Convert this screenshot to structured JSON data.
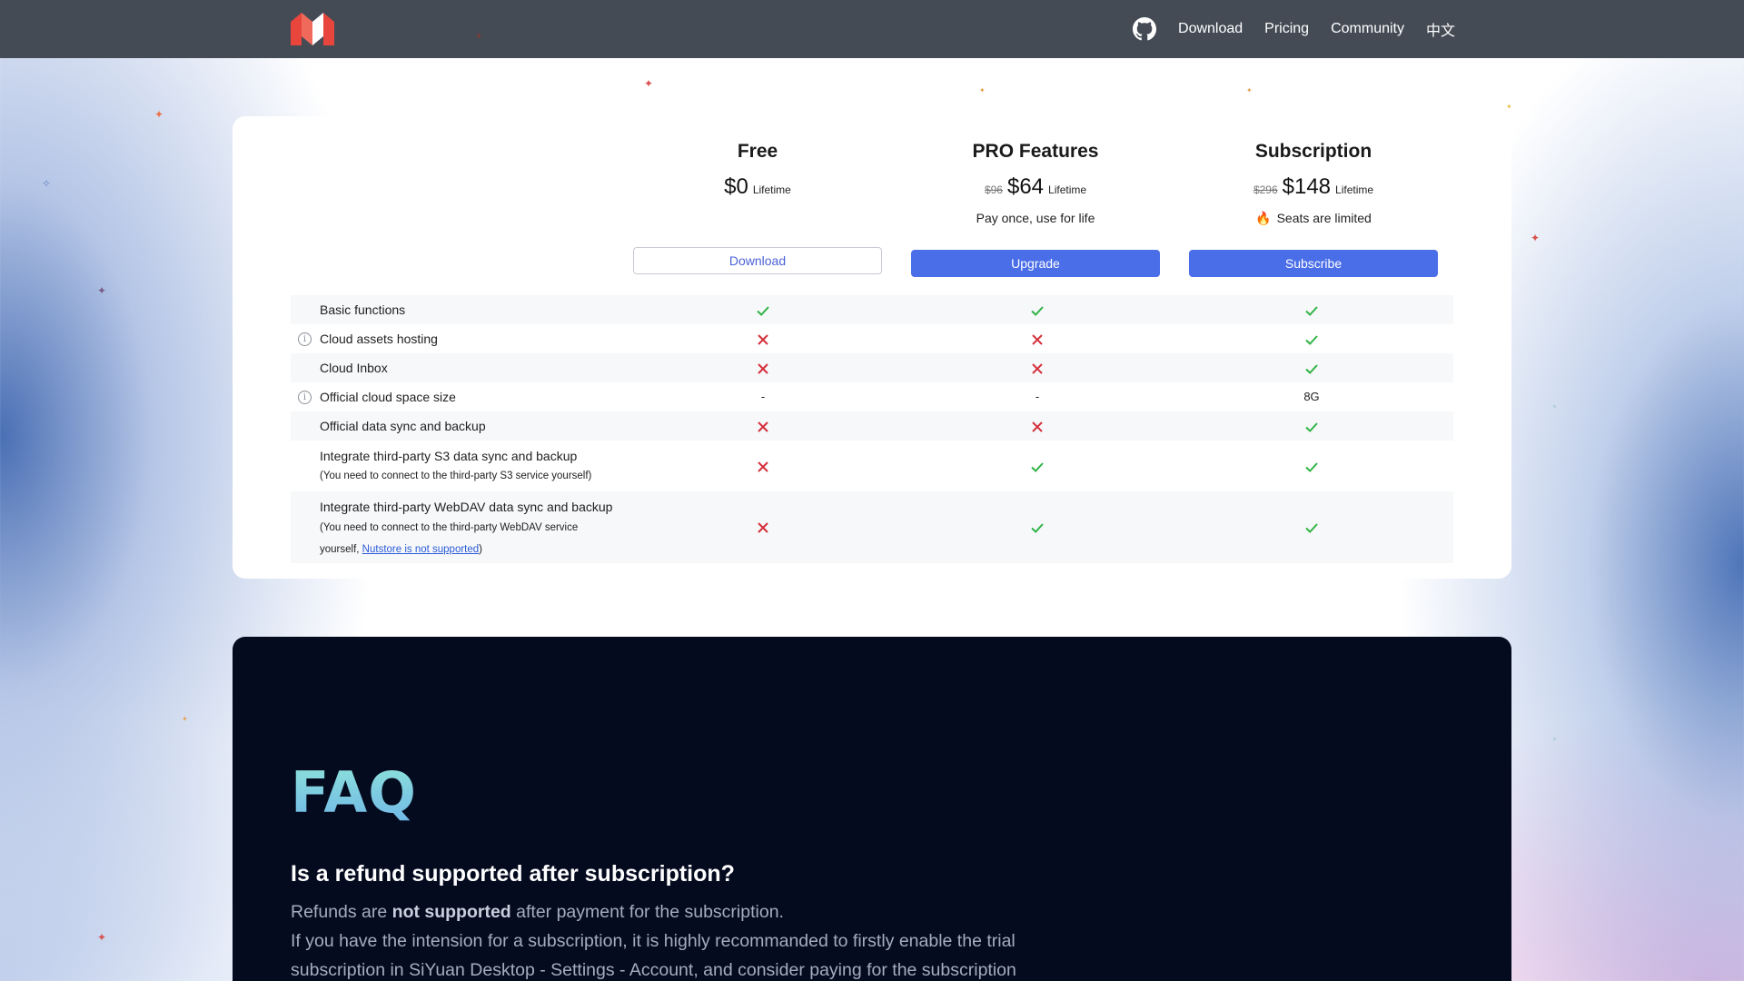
{
  "nav": {
    "items": [
      {
        "label": "Download"
      },
      {
        "label": "Pricing"
      },
      {
        "label": "Community"
      },
      {
        "label": "中文"
      }
    ]
  },
  "plans": [
    {
      "name": "Free",
      "old_price": "",
      "price": "$0",
      "period": "Lifetime",
      "note": "",
      "button": "Download"
    },
    {
      "name": "PRO Features",
      "old_price": "$96",
      "price": "$64",
      "period": "Lifetime",
      "note": "Pay once, use for life",
      "button": "Upgrade"
    },
    {
      "name": "Subscription",
      "old_price": "$296",
      "price": "$148",
      "period": "Lifetime",
      "note": "Seats are limited",
      "button": "Subscribe"
    }
  ],
  "features": [
    {
      "label": "Basic functions",
      "info": false,
      "values": [
        "check",
        "check",
        "check"
      ]
    },
    {
      "label": "Cloud assets hosting",
      "info": true,
      "values": [
        "cross",
        "cross",
        "check"
      ]
    },
    {
      "label": "Cloud Inbox",
      "info": false,
      "values": [
        "cross",
        "cross",
        "check"
      ]
    },
    {
      "label": "Official cloud space size",
      "info": true,
      "values": [
        "-",
        "-",
        "8G"
      ]
    },
    {
      "label": "Official data sync and backup",
      "info": false,
      "values": [
        "cross",
        "cross",
        "check"
      ]
    },
    {
      "label": "Integrate third-party S3 data sync and backup",
      "sub": "(You need to connect to the third-party S3 service yourself)",
      "info": false,
      "values": [
        "cross",
        "check",
        "check"
      ]
    },
    {
      "label": "Integrate third-party WebDAV data sync and backup",
      "sub_pre": "(You need to connect to the third-party WebDAV service yourself, ",
      "sub_link": "Nutstore is not supported",
      "sub_post": ")",
      "info": false,
      "values": [
        "cross",
        "check",
        "check"
      ]
    }
  ],
  "faq": {
    "title": "FAQ",
    "question": "Is a refund supported after subscription?",
    "answer_pre": "Refunds are ",
    "answer_bold": "not supported",
    "answer_post": " after payment for the subscription.",
    "answer_2": "If you have the intension for a subscription, it is highly recommanded to firstly enable the trial subscription in SiYuan Desktop - Settings - Account, and consider paying for the subscription"
  },
  "colors": {
    "check": "#2fb344",
    "cross": "#d42f3a",
    "primary_button": "#4a6ee8",
    "header_bg": "#454b55",
    "faq_bg": "#050b1f"
  }
}
